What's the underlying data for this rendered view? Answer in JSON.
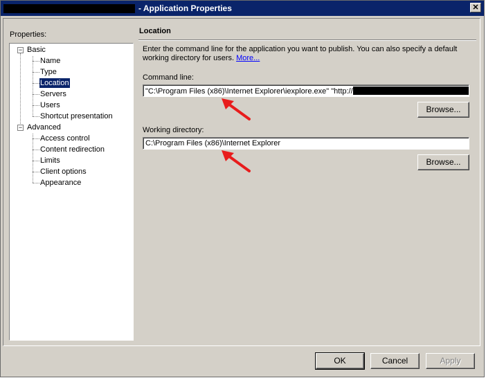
{
  "window": {
    "title": "- Application Properties",
    "close_glyph": "✕"
  },
  "properties_label": "Properties:",
  "tree": {
    "basic": {
      "label": "Basic",
      "expander": "−"
    },
    "basic_children": [
      {
        "label": "Name"
      },
      {
        "label": "Type"
      },
      {
        "label": "Location",
        "selected": true
      },
      {
        "label": "Servers"
      },
      {
        "label": "Users"
      },
      {
        "label": "Shortcut presentation"
      }
    ],
    "advanced": {
      "label": "Advanced",
      "expander": "−"
    },
    "advanced_children": [
      {
        "label": "Access control"
      },
      {
        "label": "Content redirection"
      },
      {
        "label": "Limits"
      },
      {
        "label": "Client options"
      },
      {
        "label": "Appearance"
      }
    ]
  },
  "location": {
    "title": "Location",
    "description": "Enter the command line for the application you want to publish.  You can also specify a default working directory for users.",
    "more_link": "More...",
    "command_line_label": "Command line:",
    "command_line_value": "\"C:\\Program Files (x86)\\Internet Explorer\\iexplore.exe\" \"http://",
    "working_dir_label": "Working directory:",
    "working_dir_value": "C:\\Program Files (x86)\\Internet Explorer",
    "browse_label": "Browse..."
  },
  "footer": {
    "ok": "OK",
    "cancel": "Cancel",
    "apply": "Apply"
  },
  "colors": {
    "titlebar": "#0a246a",
    "face": "#d4d0c8",
    "annotation_arrow": "#e81c1c"
  }
}
